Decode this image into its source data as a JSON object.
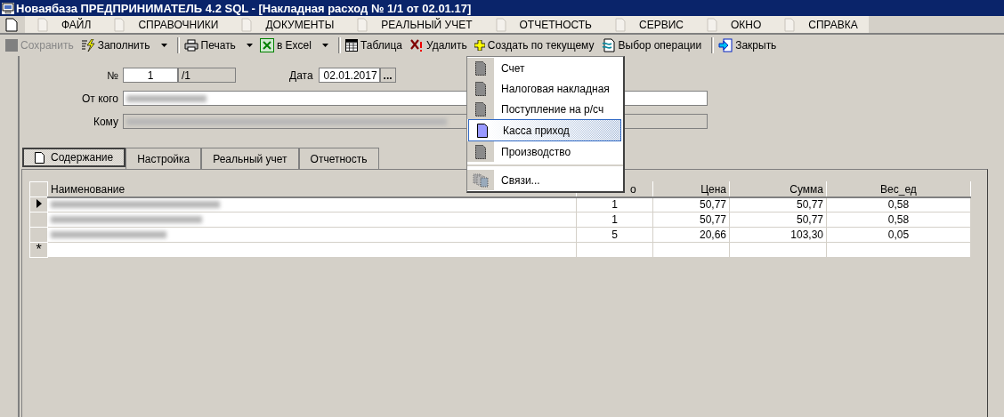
{
  "window": {
    "title": "Новаябаза  ПРЕДПРИНИМАТЕЛЬ 4.2 SQL - [Накладная расход № 1/1 от 02.01.17]"
  },
  "menu": [
    {
      "label": "ФАЙЛ"
    },
    {
      "label": "СПРАВОЧНИКИ"
    },
    {
      "label": "ДОКУМЕНТЫ"
    },
    {
      "label": "РЕАЛЬНЫЙ УЧЕТ"
    },
    {
      "label": "ОТЧЕТНОСТЬ"
    },
    {
      "label": "СЕРВИС"
    },
    {
      "label": "ОКНО"
    },
    {
      "label": "СПРАВКА"
    }
  ],
  "toolbar": [
    {
      "kind": "button",
      "label": "Сохранить",
      "disabled": true,
      "dropdown": false
    },
    {
      "kind": "button",
      "label": "Заполнить",
      "disabled": false,
      "dropdown": true
    },
    {
      "kind": "separator"
    },
    {
      "kind": "button",
      "label": "Печать",
      "disabled": false,
      "dropdown": true
    },
    {
      "kind": "button",
      "label": "в Excel",
      "disabled": false,
      "dropdown": true
    },
    {
      "kind": "separator"
    },
    {
      "kind": "button",
      "label": "Таблица",
      "disabled": false,
      "dropdown": false
    },
    {
      "kind": "button",
      "label": "Удалить",
      "disabled": false,
      "dropdown": false
    },
    {
      "kind": "button",
      "label": "Создать по текущему",
      "disabled": false,
      "dropdown": false
    },
    {
      "kind": "button",
      "label": "Выбор операции",
      "disabled": false,
      "dropdown": false
    },
    {
      "kind": "separator"
    },
    {
      "kind": "button",
      "label": "Закрыть",
      "disabled": false,
      "dropdown": false
    }
  ],
  "form": {
    "number_label": "№",
    "number": "1",
    "number_suffix": "/1",
    "date_label": "Дата",
    "date": "02.01.2017",
    "date_button": "...",
    "from_label": "От кого",
    "to_label": "Кому"
  },
  "tabs": [
    {
      "label": "Содержание",
      "selected": true
    },
    {
      "label": "Настройка",
      "selected": false
    },
    {
      "label": "Реальный учет",
      "selected": false
    },
    {
      "label": "Отчетность",
      "selected": false
    }
  ],
  "table": {
    "columns": [
      "Наименование",
      "о",
      "Цена",
      "Сумма",
      "Вес_ед"
    ],
    "rows": [
      {
        "current": true,
        "cells": [
          "",
          "1",
          "50,77",
          "50,77",
          "0,58"
        ]
      },
      {
        "current": false,
        "cells": [
          "",
          "1",
          "50,77",
          "50,77",
          "0,58"
        ]
      },
      {
        "current": false,
        "cells": [
          "",
          "5",
          "20,66",
          "103,30",
          "0,05"
        ]
      }
    ],
    "new_row_marker": "*"
  },
  "popup_menu": [
    {
      "kind": "item",
      "label": "Счет",
      "selected": false
    },
    {
      "kind": "item",
      "label": "Налоговая накладная",
      "selected": false
    },
    {
      "kind": "item",
      "label": "Поступление на р/сч",
      "selected": false
    },
    {
      "kind": "item",
      "label": "Касса приход",
      "selected": true
    },
    {
      "kind": "item",
      "label": "Производство",
      "selected": false
    },
    {
      "kind": "separator"
    },
    {
      "kind": "links",
      "label": "Связи..."
    }
  ]
}
